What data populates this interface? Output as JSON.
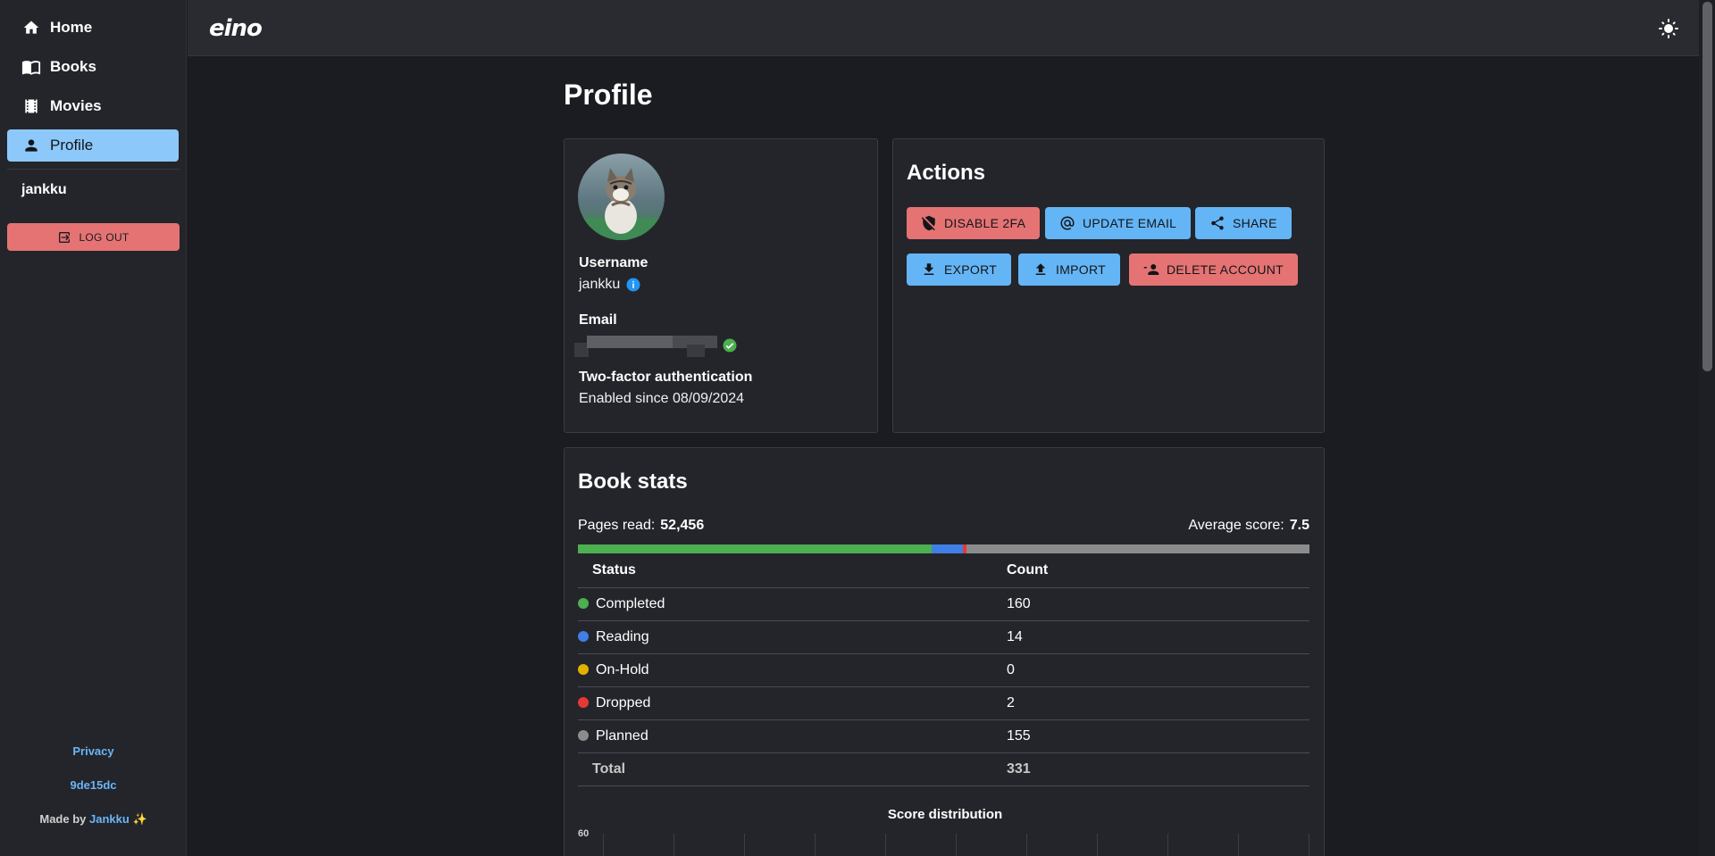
{
  "sidebar": {
    "items": [
      {
        "label": "Home",
        "icon": "home-icon"
      },
      {
        "label": "Books",
        "icon": "book-open-icon"
      },
      {
        "label": "Movies",
        "icon": "film-icon"
      },
      {
        "label": "Profile",
        "icon": "account-icon",
        "active": true
      }
    ],
    "username": "jankku",
    "logout_label": "LOG OUT",
    "footer": {
      "privacy": "Privacy",
      "commit": "9de15dc",
      "made_by_prefix": "Made by",
      "made_by_name": "Jankku",
      "made_by_emoji": "✨"
    }
  },
  "topbar": {
    "logo": "eino",
    "theme_icon": "sun-icon"
  },
  "page": {
    "title": "Profile"
  },
  "profile": {
    "username_label": "Username",
    "username": "jankku",
    "email_label": "Email",
    "twofa_label": "Two-factor authentication",
    "twofa_value": "Enabled since 08/09/2024"
  },
  "actions": {
    "title": "Actions",
    "buttons": [
      {
        "label": "DISABLE 2FA",
        "icon": "shield-off-icon",
        "color": "#e57373"
      },
      {
        "label": "UPDATE EMAIL",
        "icon": "at-icon",
        "color": "#64b5f6"
      },
      {
        "label": "SHARE",
        "icon": "share-icon",
        "color": "#64b5f6"
      },
      {
        "label": "EXPORT",
        "icon": "download-icon",
        "color": "#64b5f6"
      },
      {
        "label": "IMPORT",
        "icon": "upload-icon",
        "color": "#64b5f6"
      },
      {
        "label": "DELETE ACCOUNT",
        "icon": "account-remove-icon",
        "color": "#e57373"
      }
    ]
  },
  "book_stats": {
    "title": "Book stats",
    "pages_read_label": "Pages read:",
    "pages_read": "52,456",
    "avg_score_label": "Average score:",
    "avg_score": "7.5",
    "table_headers": {
      "status": "Status",
      "count": "Count"
    },
    "rows": [
      {
        "status": "Completed",
        "count": "160",
        "color": "#4caf50"
      },
      {
        "status": "Reading",
        "count": "14",
        "color": "#3f7fe6"
      },
      {
        "status": "On-Hold",
        "count": "0",
        "color": "#e2b100"
      },
      {
        "status": "Dropped",
        "count": "2",
        "color": "#e53935"
      },
      {
        "status": "Planned",
        "count": "155",
        "color": "#8c8c8c"
      }
    ],
    "total_label": "Total",
    "total": "331",
    "chart_title": "Score distribution",
    "chart_y_top": "60"
  }
}
